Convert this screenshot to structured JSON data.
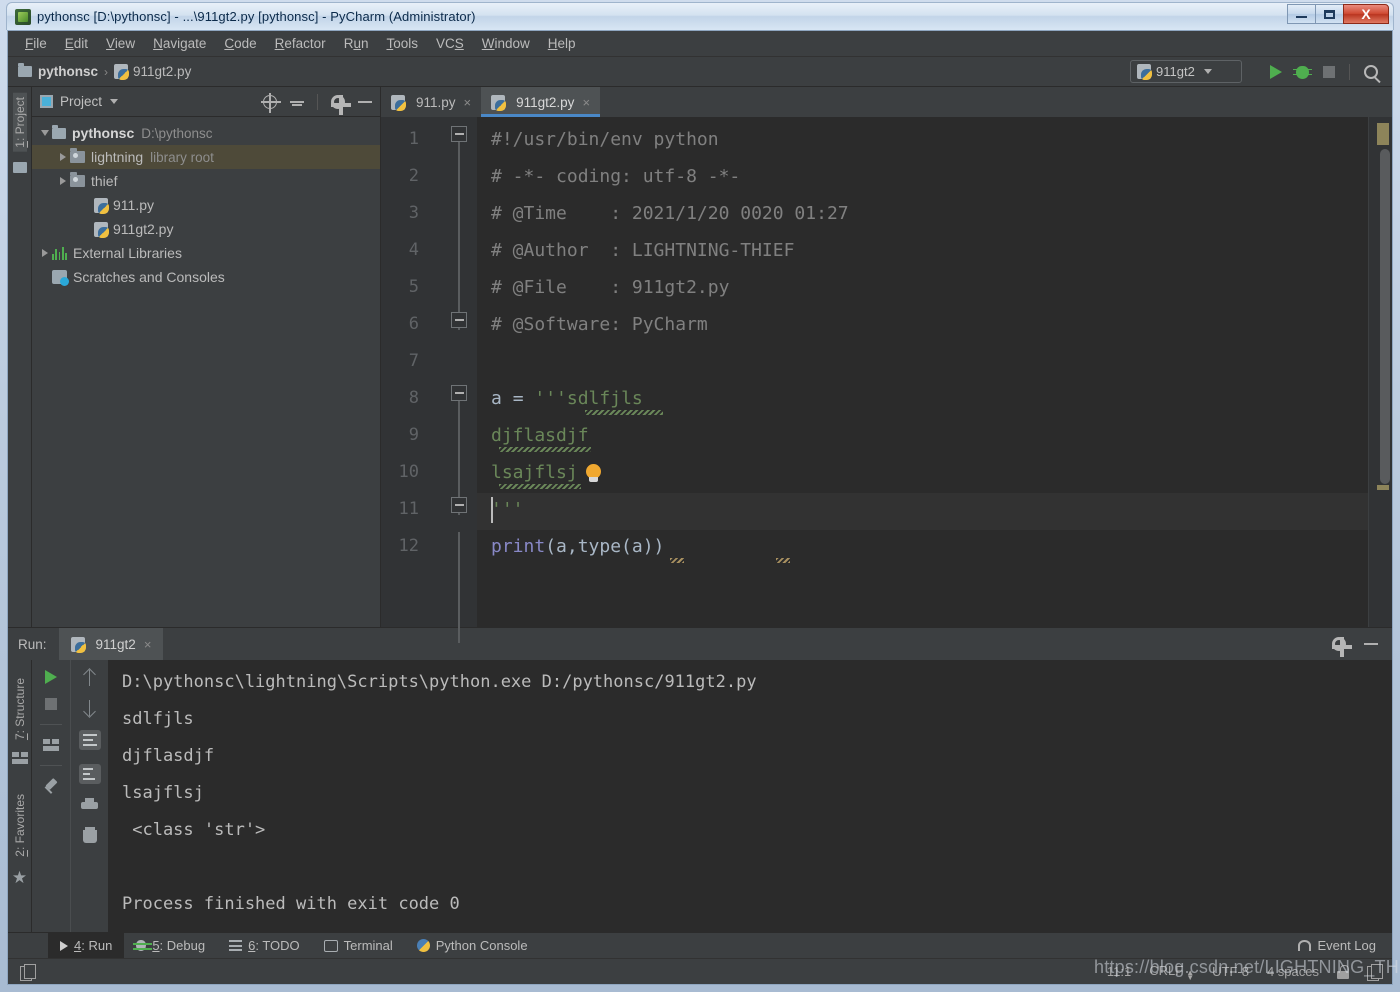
{
  "window": {
    "title": "pythonsc [D:\\pythonsc] - ...\\911gt2.py [pythonsc] - PyCharm (Administrator)",
    "minimize_label": "Minimize",
    "maximize_label": "Maximize",
    "close_label": "X"
  },
  "menubar": [
    {
      "pre": "F",
      "rest": "ile"
    },
    {
      "pre": "E",
      "rest": "dit"
    },
    {
      "pre": "V",
      "rest": "iew"
    },
    {
      "pre": "N",
      "rest": "avigate"
    },
    {
      "pre": "C",
      "rest": "ode"
    },
    {
      "pre": "R",
      "rest": "efactor"
    },
    {
      "pre": "Ru",
      "rest": "n",
      "mid": true
    },
    {
      "pre": "T",
      "rest": "ools"
    },
    {
      "pre": "VCS",
      "rest": ""
    },
    {
      "pre": "W",
      "rest": "indow"
    },
    {
      "pre": "H",
      "rest": "elp"
    }
  ],
  "navbar": {
    "crumb_project": "pythonsc",
    "crumb_sep": "›",
    "crumb_file": "911gt2.py",
    "run_config": "911gt2",
    "run_button": "Run",
    "debug_button": "Debug",
    "stop_button": "Stop",
    "search_button": "Search everywhere"
  },
  "left_strip": {
    "project_tab": {
      "num": "1",
      "label": ": Project"
    }
  },
  "bottom_left_strip": {
    "structure_tab": {
      "num": "7",
      "label": ": Structure"
    },
    "favorites_tab": {
      "num": "2",
      "label": ": Favorites"
    }
  },
  "project_pane": {
    "title": "Project",
    "icons": [
      "locate-icon",
      "collapse-all-icon",
      "settings-icon",
      "hide-icon"
    ],
    "tree": [
      {
        "depth": 0,
        "arrow": "down",
        "icon": "folder-icon",
        "name": "pythonsc",
        "bold": true,
        "sub": "D:\\pythonsc",
        "selected": false
      },
      {
        "depth": 1,
        "arrow": "right",
        "icon": "folder-src-icon",
        "name": "lightning",
        "bold": false,
        "sub": "library root",
        "selected": true
      },
      {
        "depth": 1,
        "arrow": "right",
        "icon": "folder-src-icon",
        "name": "thief",
        "bold": false,
        "sub": "",
        "selected": false
      },
      {
        "depth": 2,
        "arrow": "none",
        "icon": "python-file-icon",
        "name": "911.py",
        "bold": false,
        "sub": "",
        "selected": false
      },
      {
        "depth": 2,
        "arrow": "none",
        "icon": "python-file-icon",
        "name": "911gt2.py",
        "bold": false,
        "sub": "",
        "selected": false
      },
      {
        "depth": 0,
        "arrow": "right",
        "icon": "external-libraries-icon",
        "name": "External Libraries",
        "bold": false,
        "sub": "",
        "selected": false
      },
      {
        "depth": 0,
        "arrow": "none",
        "icon": "scratches-icon",
        "name": "Scratches and Consoles",
        "bold": false,
        "sub": "",
        "selected": false
      }
    ]
  },
  "editor": {
    "tabs": [
      {
        "label": "911.py",
        "active": false
      },
      {
        "label": "911gt2.py",
        "active": true
      }
    ],
    "line_numbers": [
      "1",
      "2",
      "3",
      "4",
      "5",
      "6",
      "7",
      "8",
      "9",
      "10",
      "11",
      "12"
    ],
    "current_line": 11,
    "lines": [
      {
        "n": 1,
        "segments": [
          {
            "text": "#!/usr/bin/env python",
            "cls": "c-comment"
          }
        ]
      },
      {
        "n": 2,
        "segments": [
          {
            "text": "# -*- coding: utf-8 -*-",
            "cls": "c-comment"
          }
        ]
      },
      {
        "n": 3,
        "segments": [
          {
            "text": "# @Time    : 2021/1/20 0020 01:27",
            "cls": "c-comment"
          }
        ]
      },
      {
        "n": 4,
        "segments": [
          {
            "text": "# @Author  : LIGHTNING-THIEF",
            "cls": "c-comment"
          }
        ]
      },
      {
        "n": 5,
        "segments": [
          {
            "text": "# @File    : 911gt2.py",
            "cls": "c-comment"
          }
        ]
      },
      {
        "n": 6,
        "segments": [
          {
            "text": "# @Software: PyCharm",
            "cls": "c-comment"
          }
        ]
      },
      {
        "n": 7,
        "segments": []
      },
      {
        "n": 8,
        "segments": [
          {
            "text": "a ",
            "cls": "c-var"
          },
          {
            "text": "= ",
            "cls": "c-paren"
          },
          {
            "text": "'''sdlfjls",
            "cls": "c-str"
          }
        ]
      },
      {
        "n": 9,
        "segments": [
          {
            "text": "djflasdjf",
            "cls": "c-str"
          }
        ]
      },
      {
        "n": 10,
        "segments": [
          {
            "text": "lsajflsj",
            "cls": "c-str"
          }
        ]
      },
      {
        "n": 11,
        "segments": [
          {
            "text": "'''",
            "cls": "c-str"
          }
        ]
      },
      {
        "n": 12,
        "segments": [
          {
            "text": "print",
            "cls": "c-fn"
          },
          {
            "text": "(a,type(a))",
            "cls": "c-paren"
          }
        ]
      }
    ],
    "intention_bulb": "intention-bulb-icon"
  },
  "run_panel": {
    "label": "Run:",
    "tab_label": "911gt2",
    "tab_close": "×",
    "settings_icon": "gear-icon",
    "hide_icon": "hide-icon",
    "tool_buttons": [
      "rerun-icon",
      "stop-icon",
      "layout-icon",
      "pin-icon",
      "up-icon",
      "down-icon",
      "soft-wrap-icon",
      "scroll-to-end-icon",
      "print-icon",
      "clear-all-icon"
    ],
    "output": [
      "D:\\pythonsc\\lightning\\Scripts\\python.exe D:/pythonsc/911gt2.py",
      "sdlfjls",
      "djflasdjf",
      "lsajflsj",
      " <class 'str'>",
      "",
      "Process finished with exit code 0"
    ]
  },
  "toolwindow_bar": {
    "buttons": [
      {
        "num": "4",
        "label": ": Run",
        "icon": "run-icon",
        "active": true
      },
      {
        "num": "5",
        "label": ": Debug",
        "icon": "debug-icon",
        "active": false
      },
      {
        "num": "6",
        "label": ": TODO",
        "icon": "todo-icon",
        "active": false
      },
      {
        "num": "",
        "label": "Terminal",
        "icon": "terminal-icon",
        "active": false
      },
      {
        "num": "",
        "label": "Python Console",
        "icon": "python-console-icon",
        "active": false
      }
    ],
    "event_log": "Event Log",
    "event_log_icon": "bell-icon"
  },
  "statusbar": {
    "stack_icon": "stack-icon",
    "caret_position": "11:1",
    "line_separator": "CRLF",
    "encoding": "UTF-8",
    "indent": "4 spaces",
    "lock_icon": "lock-icon",
    "branch_icon": "branch-icon"
  },
  "watermark": {
    "text": "https://blog.csdn.net/LIGHTNING_THIEF"
  },
  "colors": {
    "ide_bg": "#3c3f41",
    "editor_bg": "#2b2b2b",
    "accent_blue": "#4a88c7",
    "run_green": "#4fae4f",
    "string_green": "#6a8759",
    "selection_tan": "#4e4a39"
  }
}
